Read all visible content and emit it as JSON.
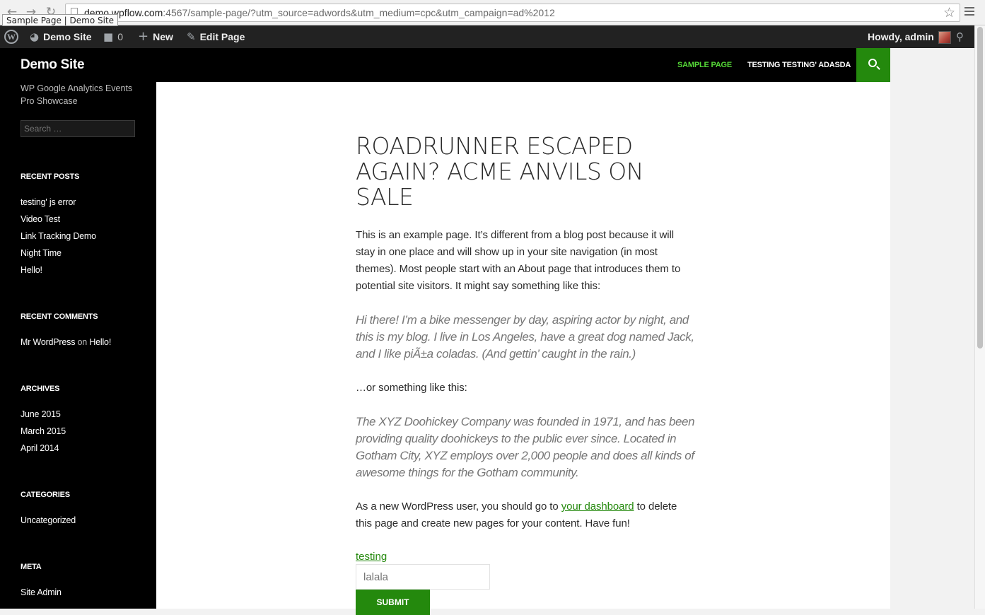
{
  "browser": {
    "url_host": "demo.wpflow.com",
    "url_rest": ":4567/sample-page/?utm_source=adwords&utm_medium=cpc&utm_campaign=ad%2012",
    "tooltip": "Sample Page | Demo Site"
  },
  "admin_bar": {
    "site_name": "Demo Site",
    "comments_count": "0",
    "new_label": "New",
    "edit_label": "Edit Page",
    "greeting": "Howdy, admin"
  },
  "site": {
    "title": "Demo Site",
    "description": "WP Google Analytics Events Pro Showcase",
    "search_placeholder": "Search …"
  },
  "nav": {
    "items": [
      "SAMPLE PAGE",
      "TESTING TESTING' ADASDA"
    ]
  },
  "widgets": {
    "recent_posts": {
      "title": "RECENT POSTS",
      "items": [
        "testing' js error",
        "Video Test",
        "Link Tracking Demo",
        "Night Time",
        "Hello!"
      ]
    },
    "recent_comments": {
      "title": "RECENT COMMENTS",
      "author": "Mr WordPress",
      "on": "on",
      "post": "Hello!"
    },
    "archives": {
      "title": "ARCHIVES",
      "items": [
        "June 2015",
        "March 2015",
        "April 2014"
      ]
    },
    "categories": {
      "title": "CATEGORIES",
      "items": [
        "Uncategorized"
      ]
    },
    "meta": {
      "title": "META",
      "items": [
        "Site Admin"
      ]
    }
  },
  "article": {
    "title": "ROADRUNNER ESCAPED AGAIN? ACME ANVILS ON SALE",
    "p1": "This is an example page. It’s different from a blog post because it will stay in one place and will show up in your site navigation (in most themes). Most people start with an About page that introduces them to potential site visitors. It might say something like this:",
    "quote1": "Hi there! I’m a bike messenger by day, aspiring actor by night, and this is my blog. I live in Los Angeles, have a great dog named Jack, and I like piÃ±a coladas. (And gettin’ caught in the rain.)",
    "p2": "…or something like this:",
    "quote2": "The XYZ Doohickey Company was founded in 1971, and has been providing quality doohickeys to the public ever since. Located in Gotham City, XYZ employs over 2,000 people and does all kinds of awesome things for the Gotham community.",
    "p3_before": "As a new WordPress user, you should go to ",
    "p3_link": "your dashboard",
    "p3_after": " to delete this page and create new pages for your content. Have fun!",
    "form_link": "testing",
    "input_placeholder": "lalala",
    "submit_label": "SUBMIT"
  },
  "colors": {
    "accent": "#24890d",
    "nav_active": "#55d737",
    "sidebar_bg": "#000000",
    "admin_bar_bg": "#222222"
  }
}
